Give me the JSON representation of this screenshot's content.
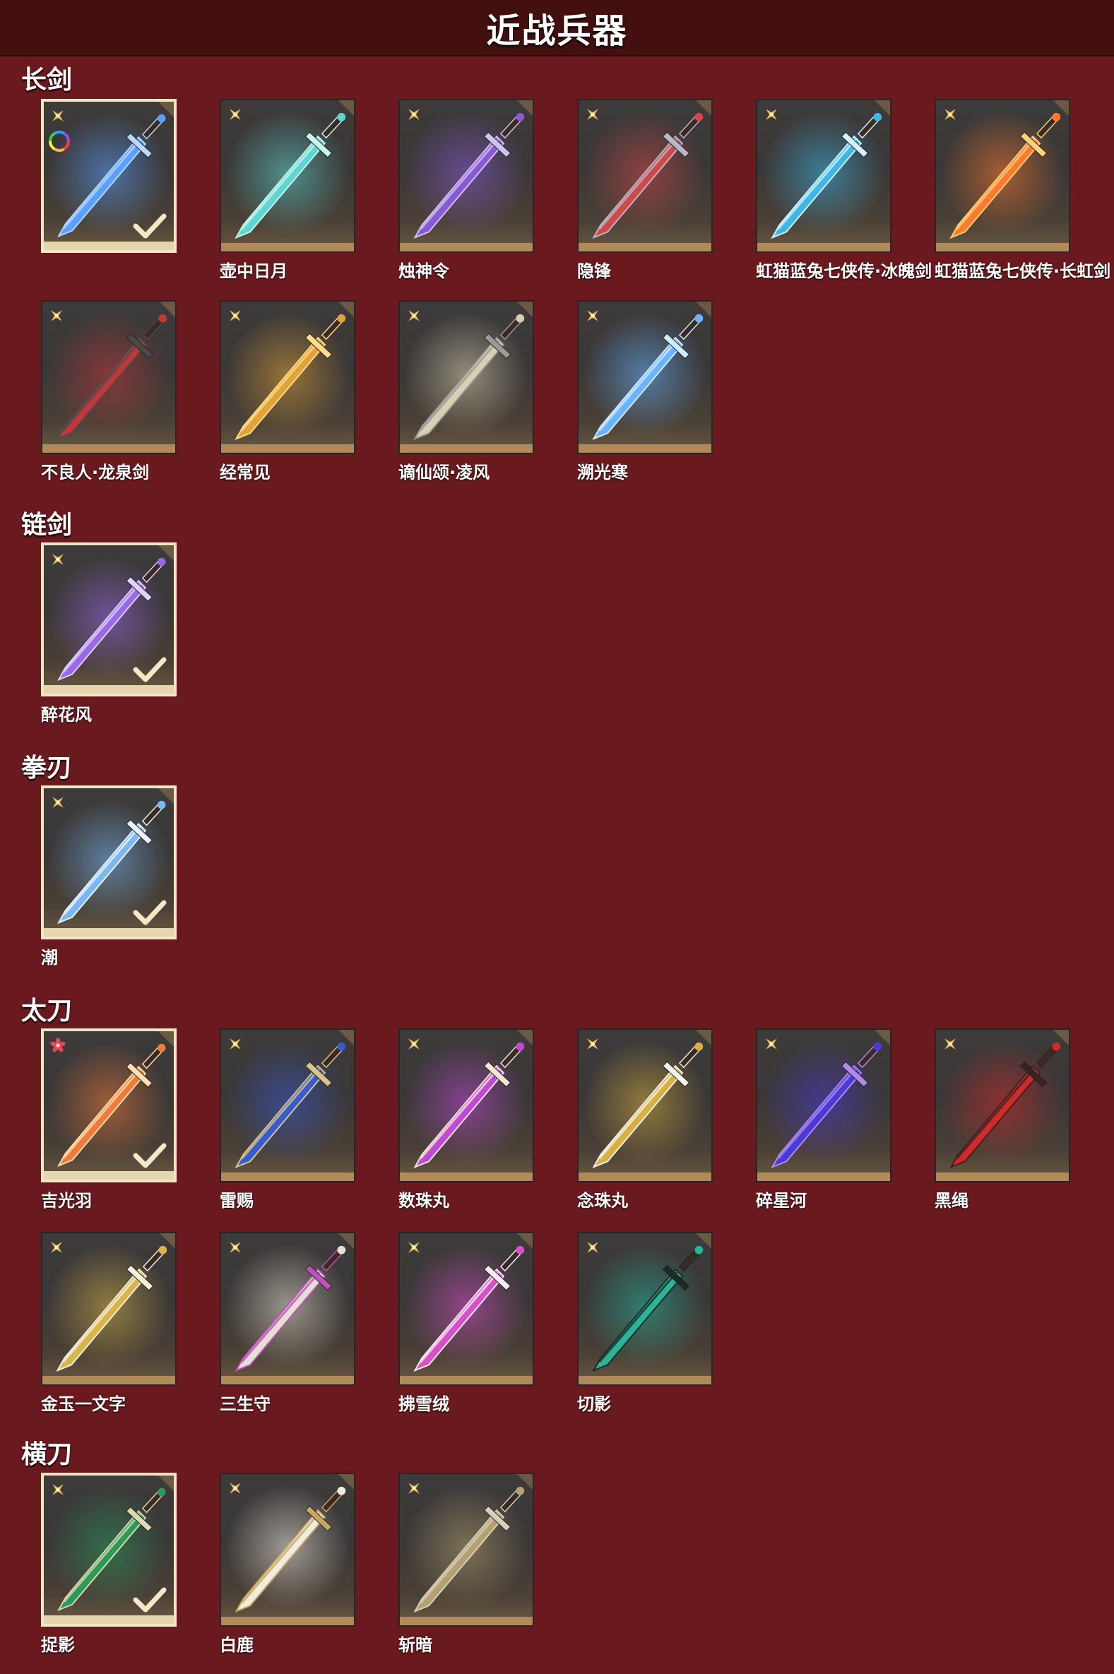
{
  "page_title": "近战兵器",
  "categories": [
    {
      "label": "长剑",
      "items": [
        {
          "name": "",
          "selected": true,
          "badge": "star",
          "rainbow": true,
          "color": "#5aa0ff",
          "accent": "#b9d8ff"
        },
        {
          "name": "壶中日月",
          "selected": false,
          "badge": "star",
          "color": "#5fd6d0",
          "accent": "#c8f5ef"
        },
        {
          "name": "烛神令",
          "selected": false,
          "badge": "star",
          "color": "#8a5ad6",
          "accent": "#cfc3ef"
        },
        {
          "name": "隐锋",
          "selected": false,
          "badge": "star",
          "color": "#d04848",
          "accent": "#b8b8c8"
        },
        {
          "name": "虹猫蓝兔七侠传·冰魄剑",
          "selected": false,
          "badge": "star",
          "color": "#3fb7e6",
          "accent": "#d6f2ff"
        },
        {
          "name": "虹猫蓝兔七侠传·长虹剑",
          "selected": false,
          "badge": "star",
          "color": "#ff7a2e",
          "accent": "#ffd07a"
        },
        {
          "name": "不良人·龙泉剑",
          "selected": false,
          "badge": "star",
          "color": "#c0383a",
          "accent": "#4a4a4a"
        },
        {
          "name": "经常见",
          "selected": false,
          "badge": "star",
          "color": "#e0a23a",
          "accent": "#ffdc8a"
        },
        {
          "name": "谪仙颂·凌风",
          "selected": false,
          "badge": "star",
          "color": "#d8d0b0",
          "accent": "#9a9a9a"
        },
        {
          "name": "溯光寒",
          "selected": false,
          "badge": "star",
          "color": "#6ab4ff",
          "accent": "#d2ecff"
        }
      ]
    },
    {
      "label": "链剑",
      "items": [
        {
          "name": "醉花风",
          "selected": true,
          "badge": "star",
          "color": "#9a6ae6",
          "accent": "#e0d2ff"
        }
      ]
    },
    {
      "label": "拳刃",
      "items": [
        {
          "name": "潮",
          "selected": true,
          "badge": "star",
          "color": "#7ab8f0",
          "accent": "#eef4ff"
        }
      ]
    },
    {
      "label": "太刀",
      "items": [
        {
          "name": "吉光羽",
          "selected": true,
          "badge": "flower",
          "color": "#f07a3a",
          "accent": "#ffe0b0"
        },
        {
          "name": "雷赐",
          "selected": false,
          "badge": "star",
          "color": "#3a5ad0",
          "accent": "#d8c58a"
        },
        {
          "name": "数珠丸",
          "selected": false,
          "badge": "star",
          "color": "#c04ad6",
          "accent": "#f4e8d4"
        },
        {
          "name": "念珠丸",
          "selected": false,
          "badge": "star",
          "color": "#d8b040",
          "accent": "#f4f2ec"
        },
        {
          "name": "碎星河",
          "selected": false,
          "badge": "star",
          "color": "#4a3ad6",
          "accent": "#b08af0"
        },
        {
          "name": "黑绳",
          "selected": false,
          "badge": "star",
          "color": "#d02a2a",
          "accent": "#3a2222"
        },
        {
          "name": "金玉一文字",
          "selected": false,
          "badge": "star",
          "color": "#d8b44a",
          "accent": "#f4f0e0"
        },
        {
          "name": "三生守",
          "selected": false,
          "badge": "star",
          "color": "#e6e0d0",
          "accent": "#c050c0"
        },
        {
          "name": "拂雪绒",
          "selected": false,
          "badge": "star",
          "color": "#d850c8",
          "accent": "#f4eef4"
        },
        {
          "name": "切影",
          "selected": false,
          "badge": "star",
          "color": "#2ab49a",
          "accent": "#1a2a24"
        }
      ]
    },
    {
      "label": "横刀",
      "items": [
        {
          "name": "捉影",
          "selected": true,
          "badge": "star",
          "color": "#2a9a5a",
          "accent": "#e0d8b0"
        },
        {
          "name": "白鹿",
          "selected": false,
          "badge": "star",
          "color": "#f0ece0",
          "accent": "#c8a860"
        },
        {
          "name": "斩暗",
          "selected": false,
          "badge": "star",
          "color": "#b4a070",
          "accent": "#d6d0b8"
        }
      ]
    }
  ]
}
